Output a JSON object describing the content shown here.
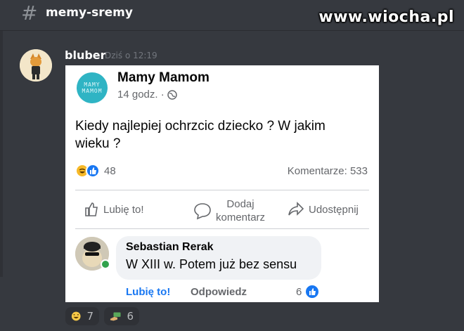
{
  "channel": {
    "name": "memy-sremy"
  },
  "watermark": "www.wiocha.pl",
  "message": {
    "author": "bluber",
    "timestamp": "Dziś o 12:19"
  },
  "post": {
    "page_name": "Mamy Mamom",
    "page_avatar_lines": [
      "MAMY",
      "MAMOM"
    ],
    "time": "14 godz. ·",
    "text": "Kiedy najlepiej ochrzcic dziecko ? W jakim wieku ?",
    "reaction_count": "48",
    "comments_count": "Komentarze: 533",
    "actions": {
      "like": "Lubię to!",
      "comment_line1": "Dodaj",
      "comment_line2": "komentarz",
      "share": "Udostępnij"
    },
    "comment": {
      "author": "Sebastian Rerak",
      "text": "W XIII w. Potem już bez sensu",
      "like_label": "Lubię to!",
      "reply_label": "Odpowiedz",
      "reaction_count": "6"
    },
    "colors": {
      "accent": "#1877f2",
      "online": "#31a24c"
    }
  },
  "discord_reactions": [
    {
      "emoji": "laughing-face",
      "count": "7"
    },
    {
      "emoji": "money-hand",
      "count": "6"
    }
  ]
}
